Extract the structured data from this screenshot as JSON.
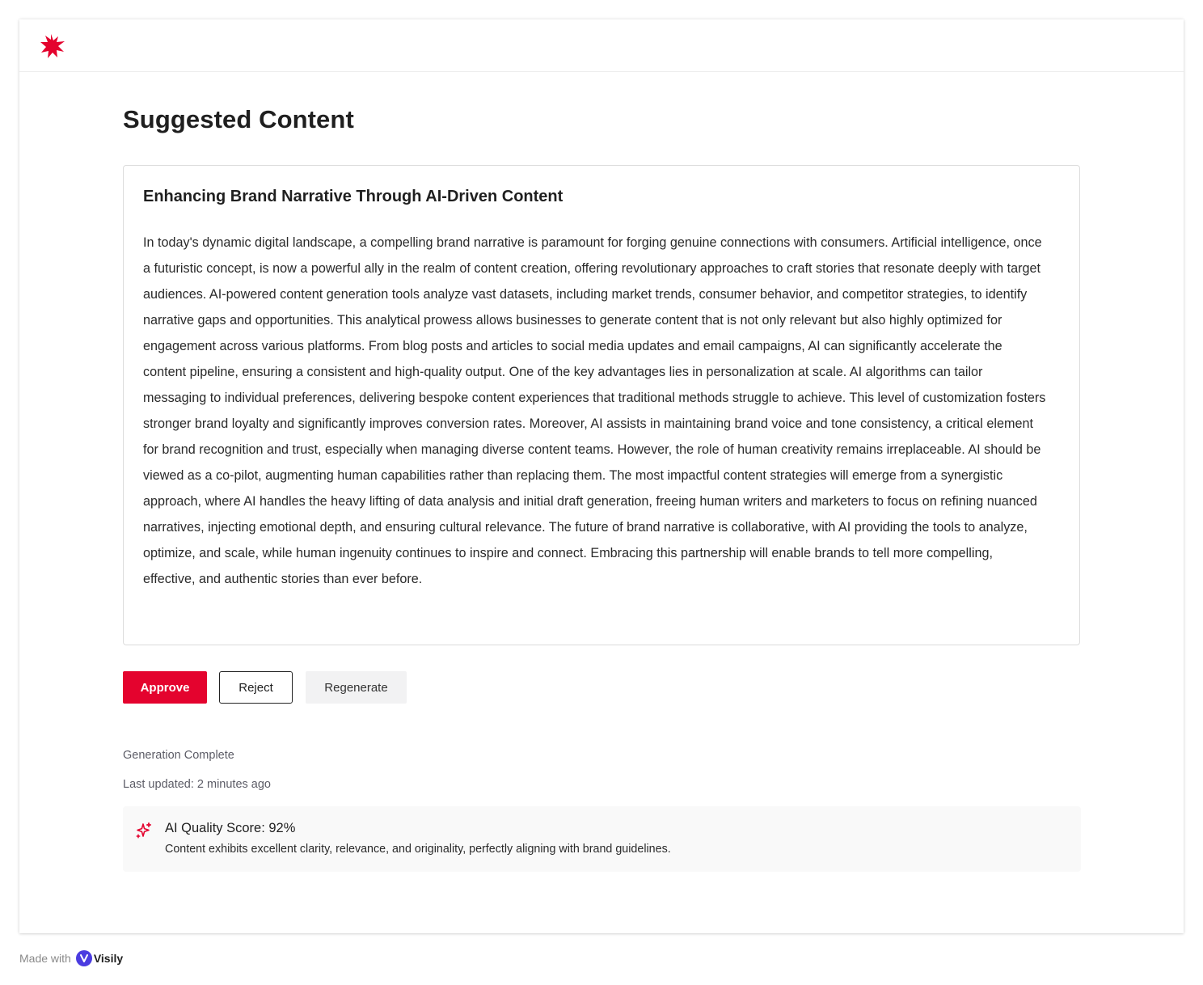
{
  "brand": {
    "accent": "#e4032e",
    "logo_icon": "star-burst-icon"
  },
  "page": {
    "title": "Suggested Content"
  },
  "card": {
    "title": "Enhancing Brand Narrative Through AI-Driven Content",
    "body": "In today's dynamic digital landscape, a compelling brand narrative is paramount for forging genuine connections with consumers. Artificial intelligence, once a futuristic concept, is now a powerful ally in the realm of content creation, offering revolutionary approaches to craft stories that resonate deeply with target audiences. AI-powered content generation tools analyze vast datasets, including market trends, consumer behavior, and competitor strategies, to identify narrative gaps and opportunities. This analytical prowess allows businesses to generate content that is not only relevant but also highly optimized for engagement across various platforms. From blog posts and articles to social media updates and email campaigns, AI can significantly accelerate the content pipeline, ensuring a consistent and high-quality output. One of the key advantages lies in personalization at scale. AI algorithms can tailor messaging to individual preferences, delivering bespoke content experiences that traditional methods struggle to achieve. This level of customization fosters stronger brand loyalty and significantly improves conversion rates. Moreover, AI assists in maintaining brand voice and tone consistency, a critical element for brand recognition and trust, especially when managing diverse content teams. However, the role of human creativity remains irreplaceable. AI should be viewed as a co-pilot, augmenting human capabilities rather than replacing them. The most impactful content strategies will emerge from a synergistic approach, where AI handles the heavy lifting of data analysis and initial draft generation, freeing human writers and marketers to focus on refining nuanced narratives, injecting emotional depth, and ensuring cultural relevance. The future of brand narrative is collaborative, with AI providing the tools to analyze, optimize, and scale, while human ingenuity continues to inspire and connect. Embracing this partnership will enable brands to tell more compelling, effective, and authentic stories than ever before."
  },
  "actions": {
    "approve_label": "Approve",
    "reject_label": "Reject",
    "regenerate_label": "Regenerate"
  },
  "status": {
    "generation": "Generation Complete",
    "last_updated": "Last updated: 2 minutes ago"
  },
  "quality": {
    "icon": "sparkle-icon",
    "title": "AI Quality Score: 92%",
    "score_percent": 92,
    "description": "Content exhibits excellent clarity, relevance, and originality, perfectly aligning with brand guidelines."
  },
  "footer": {
    "made_with": "Made with",
    "brand_name": "Visily",
    "brand_color": "#4b3ce0"
  }
}
